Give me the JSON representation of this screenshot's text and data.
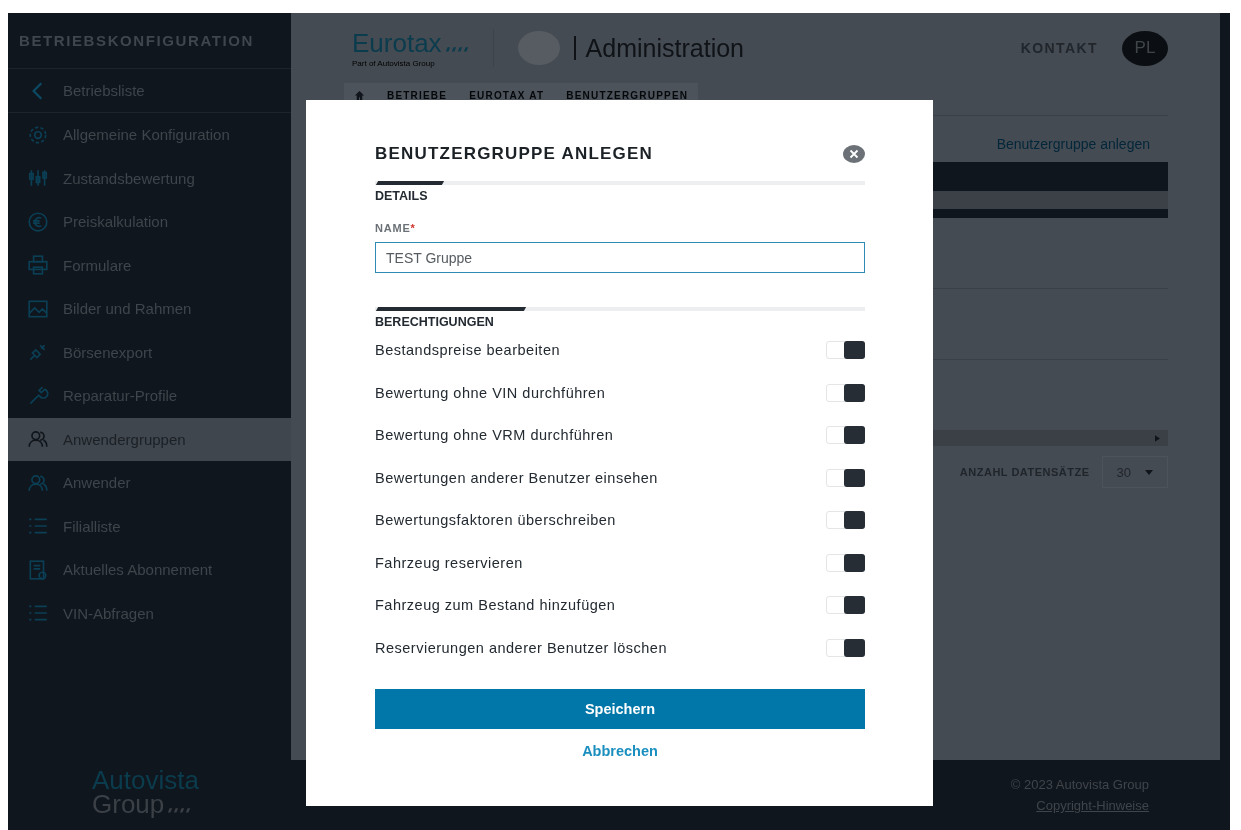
{
  "sidebar": {
    "title": "BETRIEBSKONFIGURATION",
    "back": {
      "label": "Betriebsliste"
    },
    "items": [
      {
        "label": "Allgemeine Konfiguration",
        "selected": false
      },
      {
        "label": "Zustandsbewertung",
        "selected": false
      },
      {
        "label": "Preiskalkulation",
        "selected": false
      },
      {
        "label": "Formulare",
        "selected": false
      },
      {
        "label": "Bilder und Rahmen",
        "selected": false
      },
      {
        "label": "Börsenexport",
        "selected": false
      },
      {
        "label": "Reparatur-Profile",
        "selected": false
      },
      {
        "label": "Anwendergruppen",
        "selected": true
      },
      {
        "label": "Anwender",
        "selected": false
      },
      {
        "label": "Filialliste",
        "selected": false
      },
      {
        "label": "Aktuelles Abonnement",
        "selected": false
      },
      {
        "label": "VIN-Abfragen",
        "selected": false
      }
    ],
    "logo": {
      "line1": "Autovista",
      "line2": "Group"
    }
  },
  "header": {
    "brand": "Eurotax",
    "brand_sub": "Part of Autovista Group",
    "title": "Administration",
    "contact": "KONTAKT",
    "avatar": "PL"
  },
  "breadcrumb": [
    "BETRIEBE",
    "EUROTAX AT",
    "BENUTZERGRUPPEN"
  ],
  "page": {
    "create_link": "Benutzergruppe anlegen",
    "records_label": "ANZAHL DATENSÄTZE",
    "records_value": "30"
  },
  "footer": {
    "copyright": "© 2023 Autovista Group",
    "link": "Copyright-Hinweise"
  },
  "modal": {
    "title": "BENUTZERGRUPPE ANLEGEN",
    "details_heading": "DETAILS",
    "name_label": "NAME",
    "name_required_mark": "*",
    "name_value": "TEST Gruppe",
    "permissions_heading": "BERECHTIGUNGEN",
    "permissions": [
      {
        "label": "Bestandspreise bearbeiten",
        "on": true
      },
      {
        "label": "Bewertung ohne VIN durchführen",
        "on": true
      },
      {
        "label": "Bewertung ohne VRM durchführen",
        "on": true
      },
      {
        "label": "Bewertungen anderer Benutzer einsehen",
        "on": true
      },
      {
        "label": "Bewertungsfaktoren überschreiben",
        "on": true
      },
      {
        "label": "Fahrzeug reservieren",
        "on": true
      },
      {
        "label": "Fahrzeug zum Bestand hinzufügen",
        "on": true
      },
      {
        "label": "Reservierungen anderer Benutzer löschen",
        "on": true
      }
    ],
    "save": "Speichern",
    "cancel": "Abbrechen"
  }
}
